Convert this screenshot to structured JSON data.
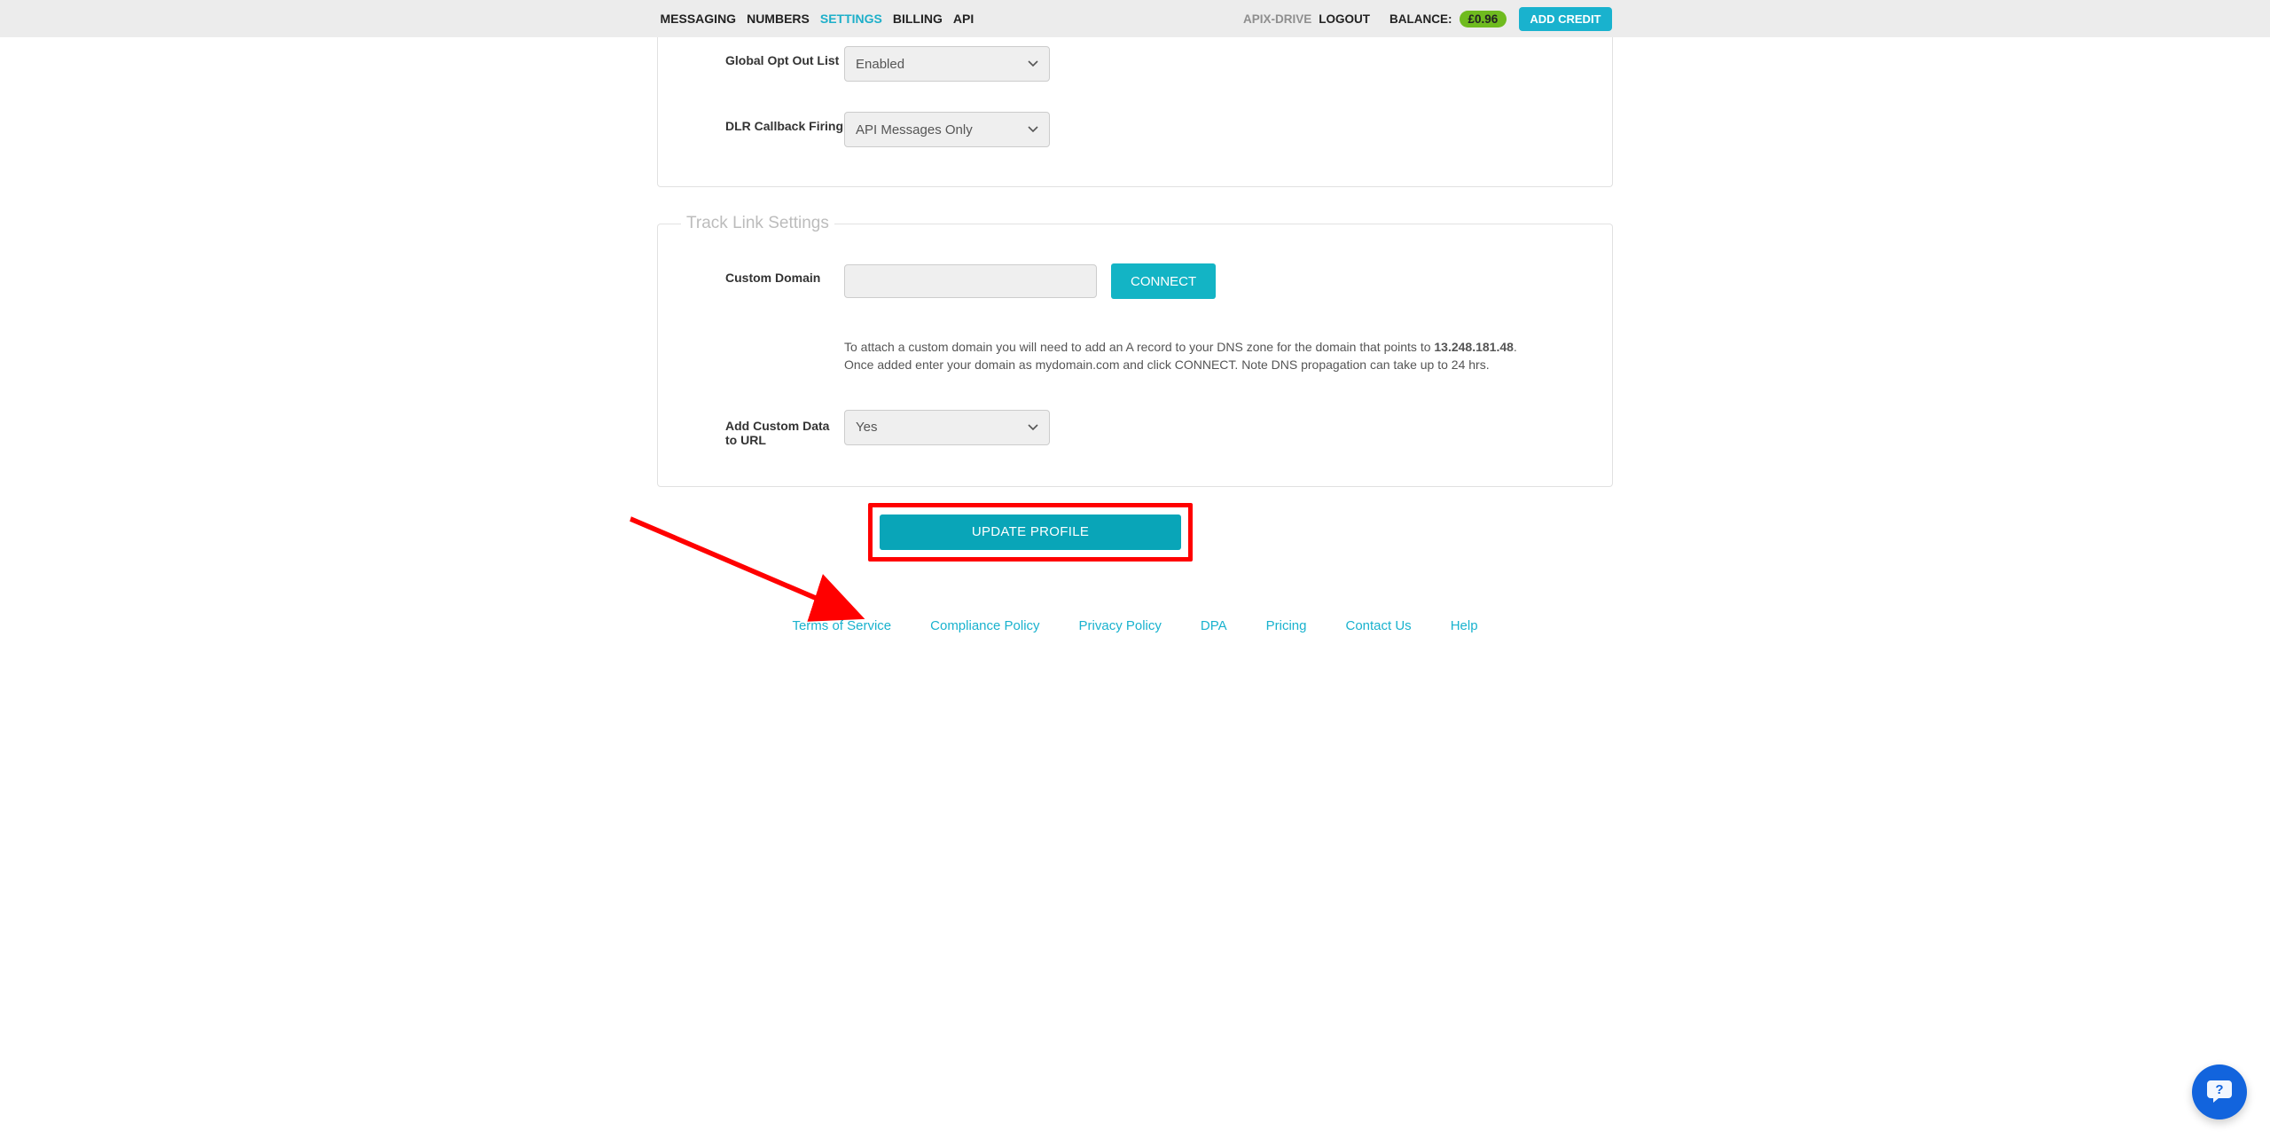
{
  "nav": {
    "left": [
      "MESSAGING",
      "NUMBERS",
      "SETTINGS",
      "BILLING",
      "API"
    ],
    "active_index": 2,
    "right": {
      "username": "APIX-DRIVE",
      "logout": "LOGOUT",
      "balance_label": "BALANCE:",
      "balance_value": "£0.96",
      "add_credit": "ADD CREDIT"
    }
  },
  "section1": {
    "rows": {
      "global_opt_out": {
        "label": "Global Opt Out List",
        "value": "Enabled"
      },
      "dlr_callback": {
        "label": "DLR Callback Firing",
        "value": "API Messages Only"
      }
    }
  },
  "section2": {
    "legend": "Track Link Settings",
    "custom_domain": {
      "label": "Custom Domain",
      "value": "",
      "connect": "CONNECT"
    },
    "helper_prefix": "To attach a custom domain you will need to add an A record to your DNS zone for the domain that points to ",
    "helper_ip": "13.248.181.48",
    "helper_suffix": ". Once added enter your domain as mydomain.com and click CONNECT. Note DNS propagation can take up to 24 hrs.",
    "add_data": {
      "label": "Add Custom Data to URL",
      "value": "Yes"
    }
  },
  "update_button": "UPDATE PROFILE",
  "footer": [
    "Terms of Service",
    "Compliance Policy",
    "Privacy Policy",
    "DPA",
    "Pricing",
    "Contact Us",
    "Help"
  ]
}
